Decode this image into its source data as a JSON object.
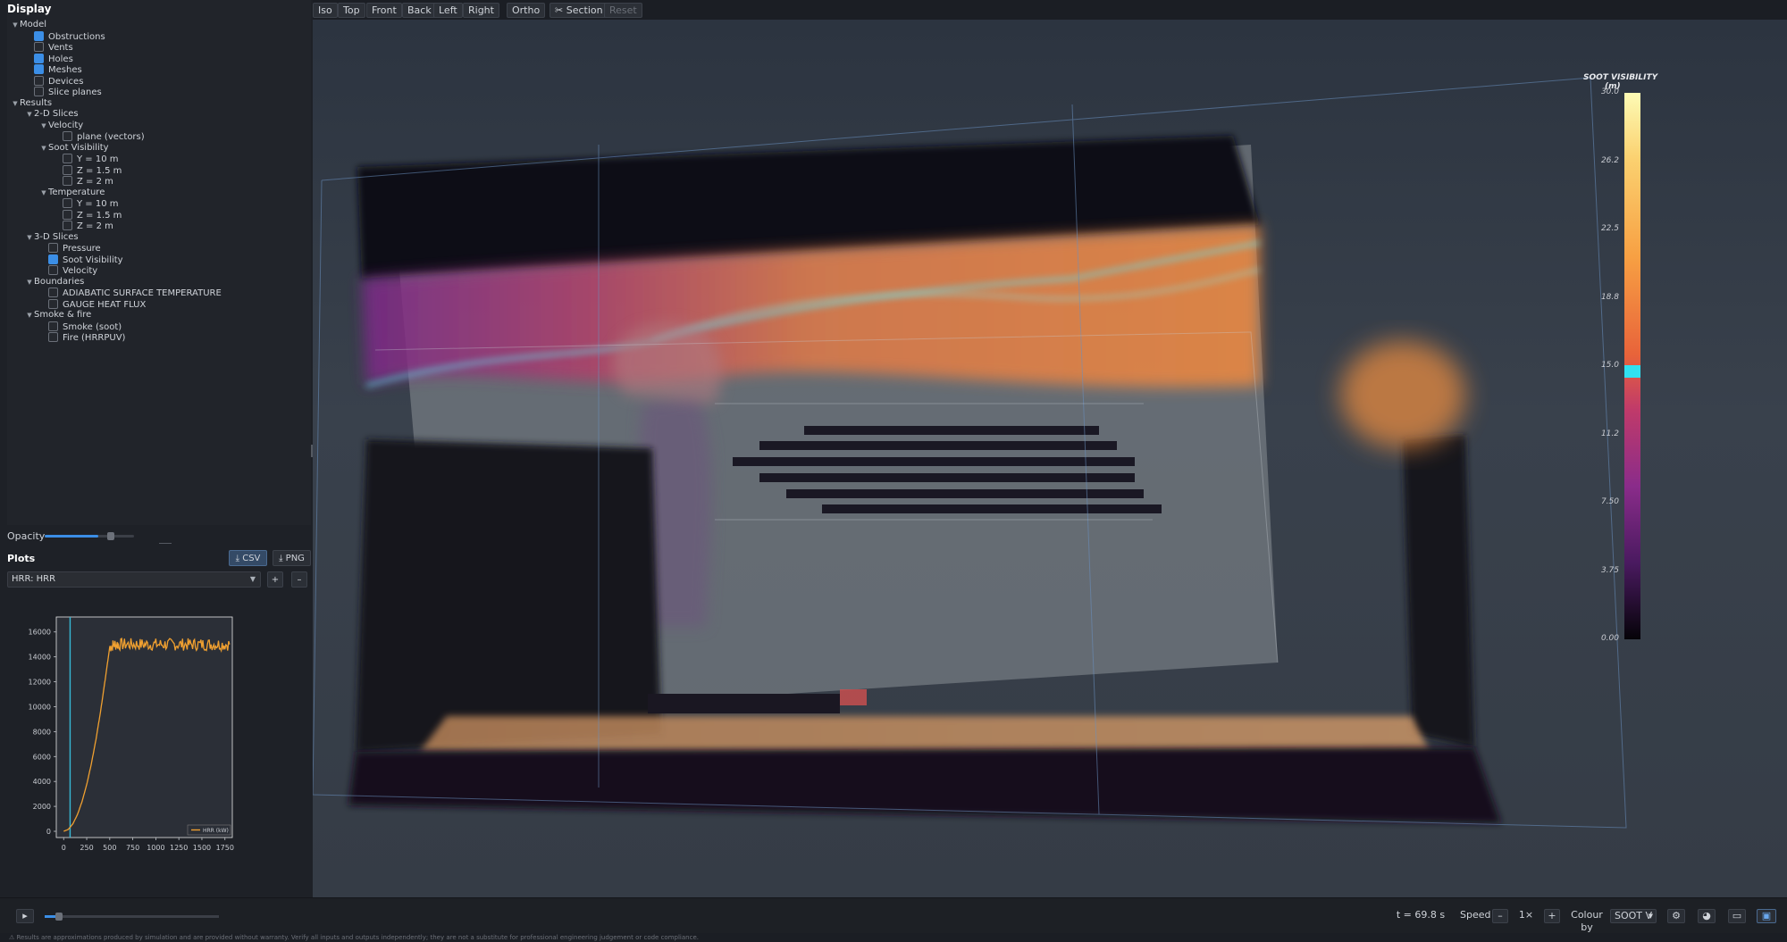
{
  "sidebar": {
    "title": "Display",
    "tree": [
      {
        "id": "t0",
        "label": "Model",
        "level": 0,
        "twisty": true,
        "checkbox": null
      },
      {
        "id": "t1",
        "label": "Obstructions",
        "level": 1,
        "twisty": false,
        "checkbox": true
      },
      {
        "id": "t2",
        "label": "Vents",
        "level": 1,
        "twisty": false,
        "checkbox": false
      },
      {
        "id": "t3",
        "label": "Holes",
        "level": 1,
        "twisty": false,
        "checkbox": true
      },
      {
        "id": "t4",
        "label": "Meshes",
        "level": 1,
        "twisty": false,
        "checkbox": true
      },
      {
        "id": "t5",
        "label": "Devices",
        "level": 1,
        "twisty": false,
        "checkbox": false
      },
      {
        "id": "t6",
        "label": "Slice planes",
        "level": 1,
        "twisty": false,
        "checkbox": false
      },
      {
        "id": "t7",
        "label": "Results",
        "level": 0,
        "twisty": true,
        "checkbox": null
      },
      {
        "id": "t8",
        "label": "2-D Slices",
        "level": 1,
        "twisty": true,
        "checkbox": null
      },
      {
        "id": "t9",
        "label": "Velocity",
        "level": 2,
        "twisty": true,
        "checkbox": null
      },
      {
        "id": "t10",
        "label": "plane (vectors)",
        "level": 3,
        "twisty": false,
        "checkbox": false
      },
      {
        "id": "t11",
        "label": "Soot Visibility",
        "level": 2,
        "twisty": true,
        "checkbox": null
      },
      {
        "id": "t12",
        "label": "Y = 10 m",
        "level": 3,
        "twisty": false,
        "checkbox": false
      },
      {
        "id": "t13",
        "label": "Z = 1.5 m",
        "level": 3,
        "twisty": false,
        "checkbox": false
      },
      {
        "id": "t14",
        "label": "Z = 2 m",
        "level": 3,
        "twisty": false,
        "checkbox": false
      },
      {
        "id": "t15",
        "label": "Temperature",
        "level": 2,
        "twisty": true,
        "checkbox": null
      },
      {
        "id": "t16",
        "label": "Y = 10 m",
        "level": 3,
        "twisty": false,
        "checkbox": false
      },
      {
        "id": "t17",
        "label": "Z = 1.5 m",
        "level": 3,
        "twisty": false,
        "checkbox": false
      },
      {
        "id": "t18",
        "label": "Z = 2 m",
        "level": 3,
        "twisty": false,
        "checkbox": false
      },
      {
        "id": "t19",
        "label": "3-D Slices",
        "level": 1,
        "twisty": true,
        "checkbox": null
      },
      {
        "id": "t20",
        "label": "Pressure",
        "level": 2,
        "twisty": false,
        "checkbox": false
      },
      {
        "id": "t21",
        "label": "Soot Visibility",
        "level": 2,
        "twisty": false,
        "checkbox": true
      },
      {
        "id": "t22",
        "label": "Velocity",
        "level": 2,
        "twisty": false,
        "checkbox": false
      },
      {
        "id": "t23",
        "label": "Boundaries",
        "level": 1,
        "twisty": true,
        "checkbox": null
      },
      {
        "id": "t24",
        "label": "ADIABATIC SURFACE TEMPERATURE",
        "level": 2,
        "twisty": false,
        "checkbox": false
      },
      {
        "id": "t25",
        "label": "GAUGE HEAT FLUX",
        "level": 2,
        "twisty": false,
        "checkbox": false
      },
      {
        "id": "t26",
        "label": "Smoke & fire",
        "level": 1,
        "twisty": true,
        "checkbox": null
      },
      {
        "id": "t27",
        "label": "Smoke (soot)",
        "level": 2,
        "twisty": false,
        "checkbox": false
      },
      {
        "id": "t28",
        "label": "Fire (HRRPUV)",
        "level": 2,
        "twisty": false,
        "checkbox": false
      }
    ],
    "opacity_label": "Opacity",
    "opacity_value": 0.6,
    "plots_title": "Plots",
    "csv_button": "⤓ CSV",
    "png_button": "⤓ PNG",
    "plot_select": "HRR: HRR",
    "add_label": "+",
    "remove_label": "–"
  },
  "chart_data": {
    "type": "line",
    "title": "",
    "xlabel": "",
    "ylabel": "",
    "xlim": [
      -80,
      1830
    ],
    "ylim": [
      -500,
      17200
    ],
    "xticks": [
      0,
      250,
      500,
      750,
      1000,
      1250,
      1500,
      1750
    ],
    "yticks": [
      0,
      2000,
      4000,
      6000,
      8000,
      10000,
      12000,
      14000,
      16000
    ],
    "cursor_x": 69.8,
    "legend_position": "bottom-right",
    "series": [
      {
        "name": "HRR (kW)",
        "color": "#f0a030",
        "x": [
          0,
          50,
          100,
          150,
          200,
          250,
          300,
          350,
          400,
          450,
          500,
          550,
          600,
          700,
          800,
          900,
          1000,
          1100,
          1200,
          1300,
          1400,
          1500,
          1600,
          1700,
          1800
        ],
        "y": [
          0,
          150,
          600,
          1350,
          2400,
          3750,
          5400,
          7350,
          9600,
          12150,
          14800,
          15000,
          15000,
          15000,
          15000,
          15000,
          15000,
          15000,
          15000,
          15000,
          15000,
          15000,
          15000,
          15000,
          15000
        ],
        "noise": 500
      }
    ]
  },
  "toolbar": {
    "buttons": [
      "Iso",
      "Top",
      "Front",
      "Back",
      "Left",
      "Right"
    ],
    "ortho": "Ortho",
    "section": "✂ Section",
    "reset": "Reset"
  },
  "colorbar": {
    "title": "SOOT VISIBILITY",
    "unit": "(m)",
    "ticks": [
      "30.0",
      "26.2",
      "22.5",
      "18.8",
      "15.0",
      "11.2",
      "7.50",
      "3.75",
      "0.00"
    ],
    "highlight_value": 14.7
  },
  "bottom": {
    "play": "▸",
    "time_value": 0.04,
    "time_label": "t = 69.8 s",
    "speed_label": "Speed",
    "speed_minus": "–",
    "speed_value": "1×",
    "speed_plus": "+",
    "colour_by": "Colour by",
    "colour_select": "SOOT V"
  },
  "footer": "⚠ Results are approximations produced by simulation and are provided without warranty. Verify all inputs and outputs independently; they are not a substitute for professional engineering judgement or code compliance."
}
